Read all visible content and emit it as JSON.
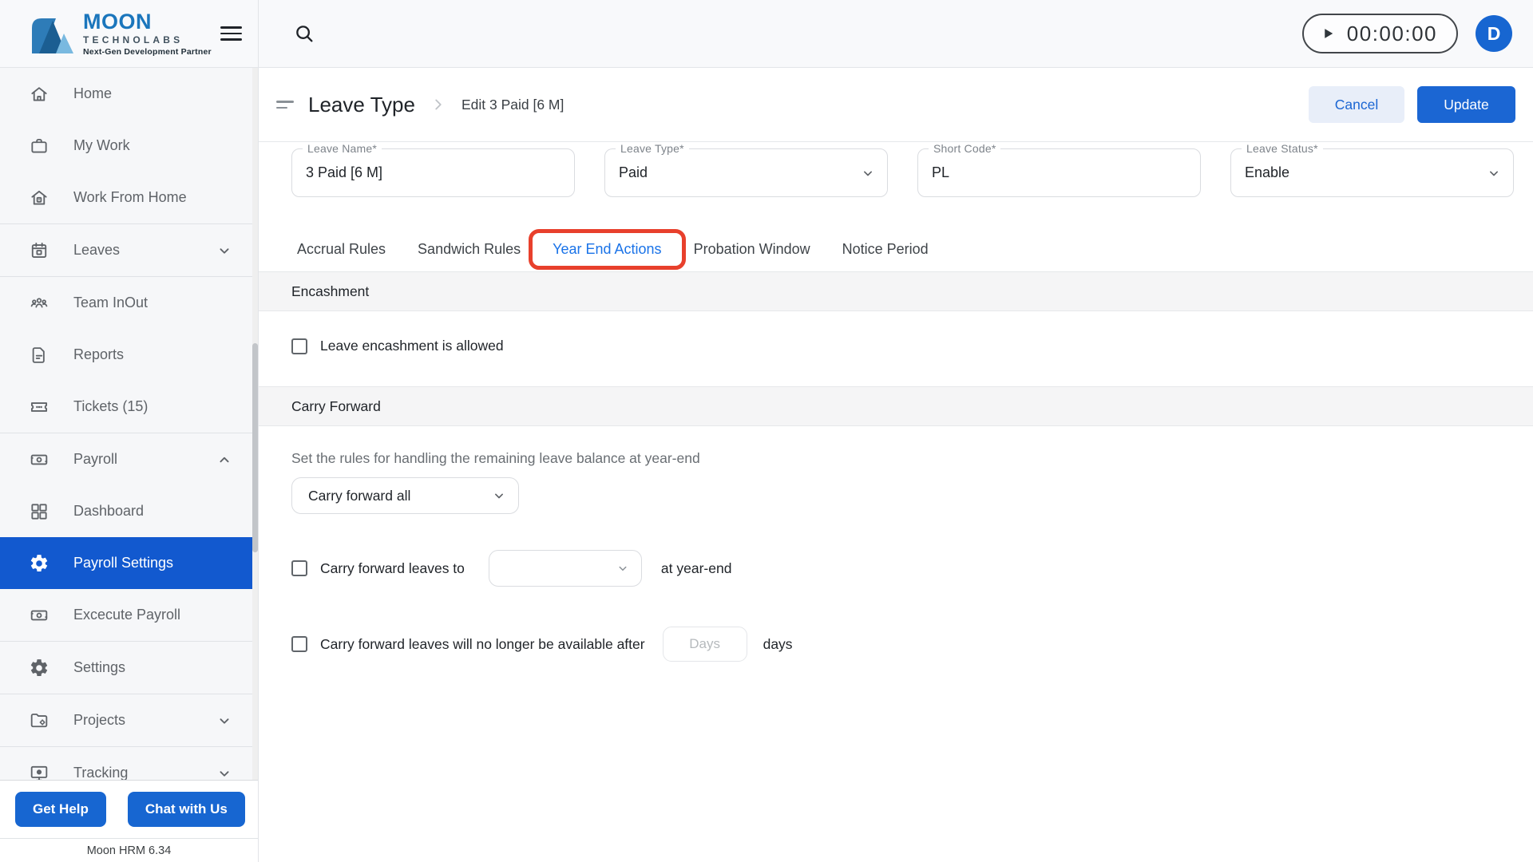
{
  "topbar": {
    "logo": {
      "name": "MOON",
      "sub": "TECHNOLABS",
      "tagline": "Next-Gen Development Partner"
    },
    "timer": "00:00:00",
    "avatar_initial": "D"
  },
  "sidebar": {
    "items": [
      {
        "label": "Home"
      },
      {
        "label": "My Work"
      },
      {
        "label": "Work From Home"
      },
      {
        "label": "Leaves",
        "expandable": "down"
      },
      {
        "label": "Team InOut"
      },
      {
        "label": "Reports"
      },
      {
        "label": "Tickets (15)"
      },
      {
        "label": "Payroll",
        "expandable": "up"
      },
      {
        "label": "Dashboard"
      },
      {
        "label": "Payroll Settings",
        "active": true
      },
      {
        "label": "Excecute Payroll"
      },
      {
        "label": "Settings"
      },
      {
        "label": "Projects",
        "expandable": "down"
      },
      {
        "label": "Tracking",
        "expandable": "down"
      }
    ],
    "get_help": "Get Help",
    "chat_with_us": "Chat with Us",
    "version": "Moon HRM 6.34"
  },
  "header": {
    "title": "Leave Type",
    "crumb": "Edit 3 Paid [6 M]",
    "cancel_label": "Cancel",
    "update_label": "Update"
  },
  "form": {
    "leave_name": {
      "label": "Leave Name*",
      "value": "3 Paid [6 M]"
    },
    "leave_type": {
      "label": "Leave Type*",
      "value": "Paid"
    },
    "short_code": {
      "label": "Short Code*",
      "value": "PL"
    },
    "leave_status": {
      "label": "Leave Status*",
      "value": "Enable"
    }
  },
  "tabs": [
    {
      "label": "Accrual Rules",
      "active": false
    },
    {
      "label": "Sandwich Rules",
      "active": false
    },
    {
      "label": "Year End Actions",
      "active": true,
      "annotated": true
    },
    {
      "label": "Probation Window",
      "active": false
    },
    {
      "label": "Notice Period",
      "active": false
    }
  ],
  "encashment": {
    "title": "Encashment",
    "checkbox_label": "Leave encashment is allowed",
    "checked": false
  },
  "carry_forward": {
    "title": "Carry Forward",
    "description": "Set the rules for handling the remaining leave balance at year-end",
    "mode_value": "Carry forward all",
    "leaves_to_label": "Carry forward leaves to",
    "leaves_to_value": "",
    "leaves_to_suffix": "at year-end",
    "leaves_to_checked": false,
    "expiry_label": "Carry forward leaves will no longer be available after",
    "days_placeholder": "Days",
    "expiry_suffix": "days",
    "expiry_checked": false
  },
  "colors": {
    "accent_blue": "#1b66d3",
    "sidebar_active_blue": "#1259cf",
    "tab_active_blue": "#1a73e8",
    "annotation_red": "#e8402c",
    "logo_blue": "#1b76bc"
  }
}
